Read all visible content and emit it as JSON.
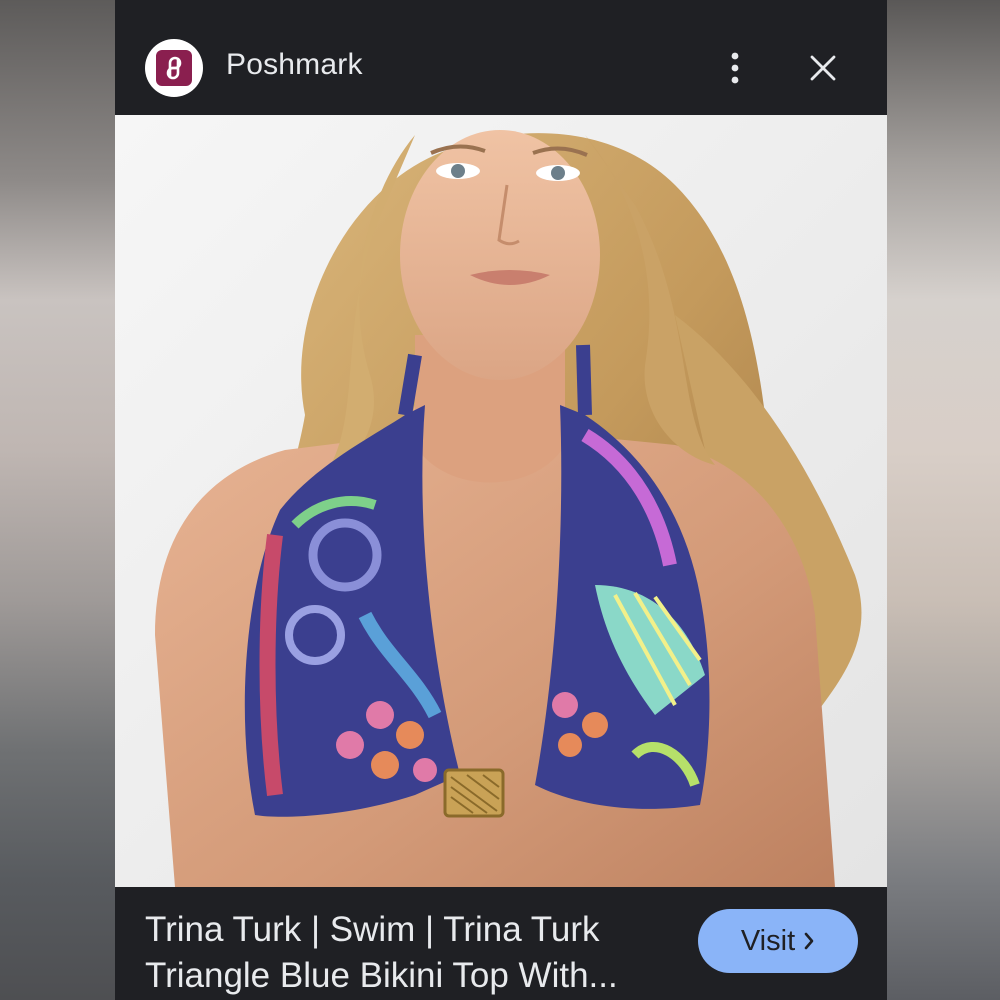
{
  "header": {
    "site_name": "Poshmark",
    "logo_icon": "poshmark-logo-icon",
    "more_icon": "more-vertical-icon",
    "close_icon": "close-icon"
  },
  "image": {
    "subject": "model-wearing-patterned-halter-bikini-top"
  },
  "footer": {
    "title_line1": "Trina Turk | Swim | Trina Turk",
    "title_line2": "Triangle Blue Bikini Top With...",
    "visit_label": "Visit",
    "visit_icon": "chevron-right-icon"
  },
  "colors": {
    "card_bg": "#1f2024",
    "text": "#e8eaed",
    "visit_button": "#8ab4f8",
    "logo_brand": "#8a1f4f"
  }
}
